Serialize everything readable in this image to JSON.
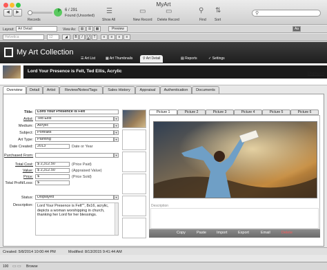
{
  "window": {
    "title": "MyArt"
  },
  "toolbar": {
    "record_count": "6 / 291",
    "found_status": "Found (Unsorted)",
    "records_label": "Records",
    "show_all": "Show All",
    "new_record": "New Record",
    "delete_record": "Delete Record",
    "find": "Find",
    "sort": "Sort",
    "search_placeholder": ""
  },
  "layoutbar": {
    "layout_label": "Layout:",
    "layout_value": "Art Detail",
    "view_label": "View As:",
    "preview": "Preview",
    "aa": "Aa"
  },
  "formatbar": {
    "font": "Helvetica",
    "size": "12",
    "bold": "B",
    "italic": "I",
    "underline": "U",
    "text": "T"
  },
  "header": {
    "title": "My Art Collection",
    "nav": [
      "Art List",
      "Art Thumbnails",
      "Art Detail",
      "Reports",
      "Settings"
    ]
  },
  "record": {
    "title": "Lord Your Presence is Felt, Ted Ellis, Acrylic",
    "status": "Displayed"
  },
  "tabs": [
    "Overview",
    "Detail",
    "Artist",
    "Review/Notes/Tags",
    "Sales History",
    "Appraisal",
    "Authentication",
    "Documents"
  ],
  "form": {
    "title_label": "Title:",
    "title": "Lord Your Presence is Felt",
    "artist_label": "Artist:",
    "artist": "Ted Ellis",
    "medium_label": "Medium:",
    "medium": "Acrylic",
    "subject_label": "Subject:",
    "subject": "Portraits",
    "arttype_label": "Art Type:",
    "arttype": "Painting",
    "date_label": "Date Created:",
    "date": "2013",
    "date_hint": "Date or Year",
    "purchased_label": "Purchased From:",
    "totalcost_label": "Total Cost:",
    "totalcost": "$ 2,312.50",
    "totalcost_hint": "(Price Paid)",
    "value_label": "Value:",
    "value": "$ 2,312.50",
    "value_hint": "(Appraised Value)",
    "price_label": "Price:",
    "price": "$",
    "price_hint": "(Price Sold)",
    "profit_label": "Total Profit/Loss:",
    "profit": "$",
    "status_label": "Status:",
    "status": "Displayed",
    "desc_label": "Description:",
    "description": "Lord Your Presence is Felt\"\", 8x16, acrylic, depicts a woman worshipping in church, thanking her Lord for her blessings."
  },
  "pictures": {
    "tabs": [
      "Picture 1",
      "Picture 2",
      "Picture 3",
      "Picture 4",
      "Picture 5",
      "Picture 6"
    ],
    "description_label": "Description",
    "actions": [
      "Copy",
      "Paste",
      "Import",
      "Export",
      "Email",
      "Delete"
    ]
  },
  "statusbar": {
    "created": "Created: 5/8/2014 10:00:44 PM",
    "modified": "Modified: 8/13/2015 9:41:44 AM"
  },
  "bottombar": {
    "zoom": "100",
    "mode": "Browse"
  },
  "colors": {
    "header_bg": "#2a2a2a",
    "delete": "#ff5a5a",
    "accent": "#3a7bd5"
  }
}
